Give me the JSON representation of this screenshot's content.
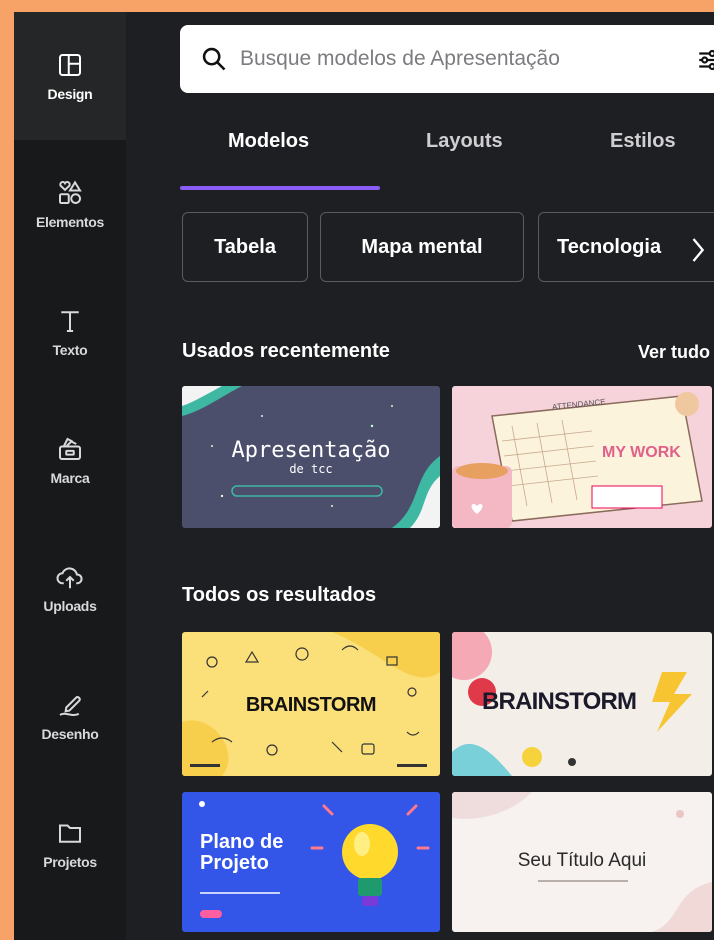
{
  "rail": {
    "items": [
      {
        "label": "Design",
        "icon": "layout-icon",
        "active": true
      },
      {
        "label": "Elementos",
        "icon": "shapes-icon"
      },
      {
        "label": "Texto",
        "icon": "text-icon"
      },
      {
        "label": "Marca",
        "icon": "brand-icon"
      },
      {
        "label": "Uploads",
        "icon": "cloud-upload-icon"
      },
      {
        "label": "Desenho",
        "icon": "draw-icon"
      },
      {
        "label": "Projetos",
        "icon": "folder-icon"
      }
    ]
  },
  "search": {
    "placeholder": "Busque modelos de Apresentação"
  },
  "tabs": [
    {
      "label": "Modelos",
      "active": true
    },
    {
      "label": "Layouts"
    },
    {
      "label": "Estilos"
    }
  ],
  "chips": [
    {
      "label": "Tabela"
    },
    {
      "label": "Mapa mental"
    },
    {
      "label": "Tecnologia"
    }
  ],
  "recent": {
    "title": "Usados recentemente",
    "see_all": "Ver tudo",
    "items": [
      {
        "title": "Apresentação",
        "subtitle": "de tcc"
      },
      {
        "title": "MY WORK",
        "banner": "ATTENDANCE"
      }
    ]
  },
  "results": {
    "title": "Todos os resultados",
    "items": [
      {
        "title": "BRAINSTORM"
      },
      {
        "title": "BRAINSTORM"
      },
      {
        "title": "Plano de Projeto"
      },
      {
        "title": "Seu Título Aqui"
      }
    ]
  },
  "colors": {
    "accent": "#8b5cf6",
    "background": "#1e1f22",
    "rail": "#18191b",
    "outer": "#f7a266"
  }
}
